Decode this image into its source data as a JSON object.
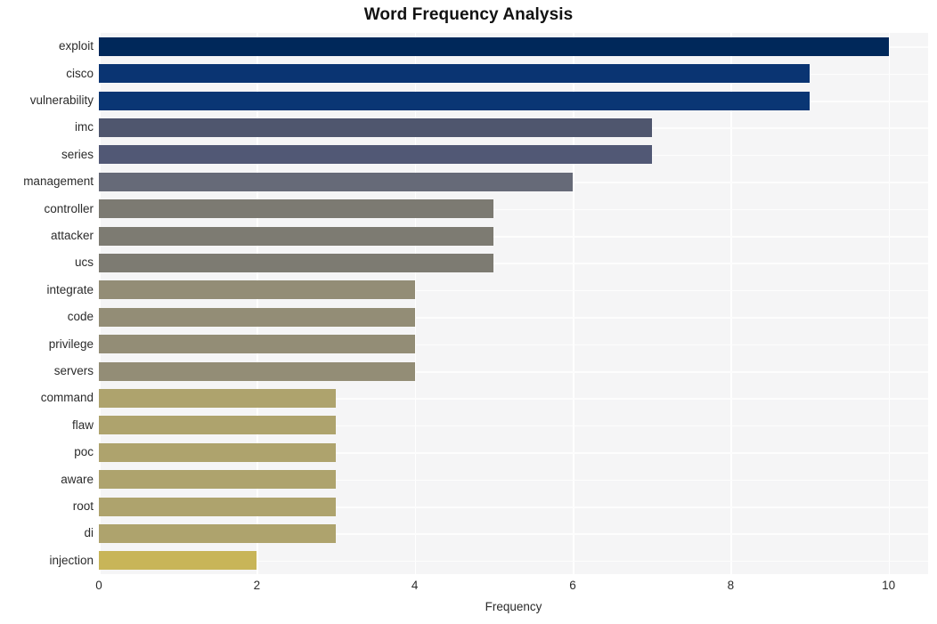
{
  "chart_data": {
    "type": "bar",
    "orientation": "horizontal",
    "title": "Word Frequency Analysis",
    "xlabel": "Frequency",
    "ylabel": "",
    "categories": [
      "exploit",
      "cisco",
      "vulnerability",
      "imc",
      "series",
      "management",
      "controller",
      "attacker",
      "ucs",
      "integrate",
      "code",
      "privilege",
      "servers",
      "command",
      "flaw",
      "poc",
      "aware",
      "root",
      "di",
      "injection"
    ],
    "values": [
      10,
      9,
      9,
      7,
      7,
      6,
      5,
      5,
      5,
      4,
      4,
      4,
      4,
      3,
      3,
      3,
      3,
      3,
      3,
      2
    ],
    "bar_colors": [
      "#00285a",
      "#0a3472",
      "#0a3674",
      "#4f566e",
      "#515875",
      "#666a78",
      "#7c7a72",
      "#7d7b72",
      "#7d7b72",
      "#938d76",
      "#938d76",
      "#938d76",
      "#938d76",
      "#aea36d",
      "#aea36d",
      "#aea36d",
      "#aea36d",
      "#aea36d",
      "#aea36d",
      "#c8b558"
    ],
    "xlim": [
      0,
      10.5
    ],
    "xticks": [
      0,
      2,
      4,
      6,
      8,
      10
    ],
    "xtick_labels": [
      "0",
      "2",
      "4",
      "6",
      "8",
      "10"
    ],
    "grid": true,
    "grid_color": "#ffffff",
    "plot_background": "#f5f5f6",
    "figure_background": "#ffffff",
    "legend": null,
    "colormap": "cividis"
  }
}
